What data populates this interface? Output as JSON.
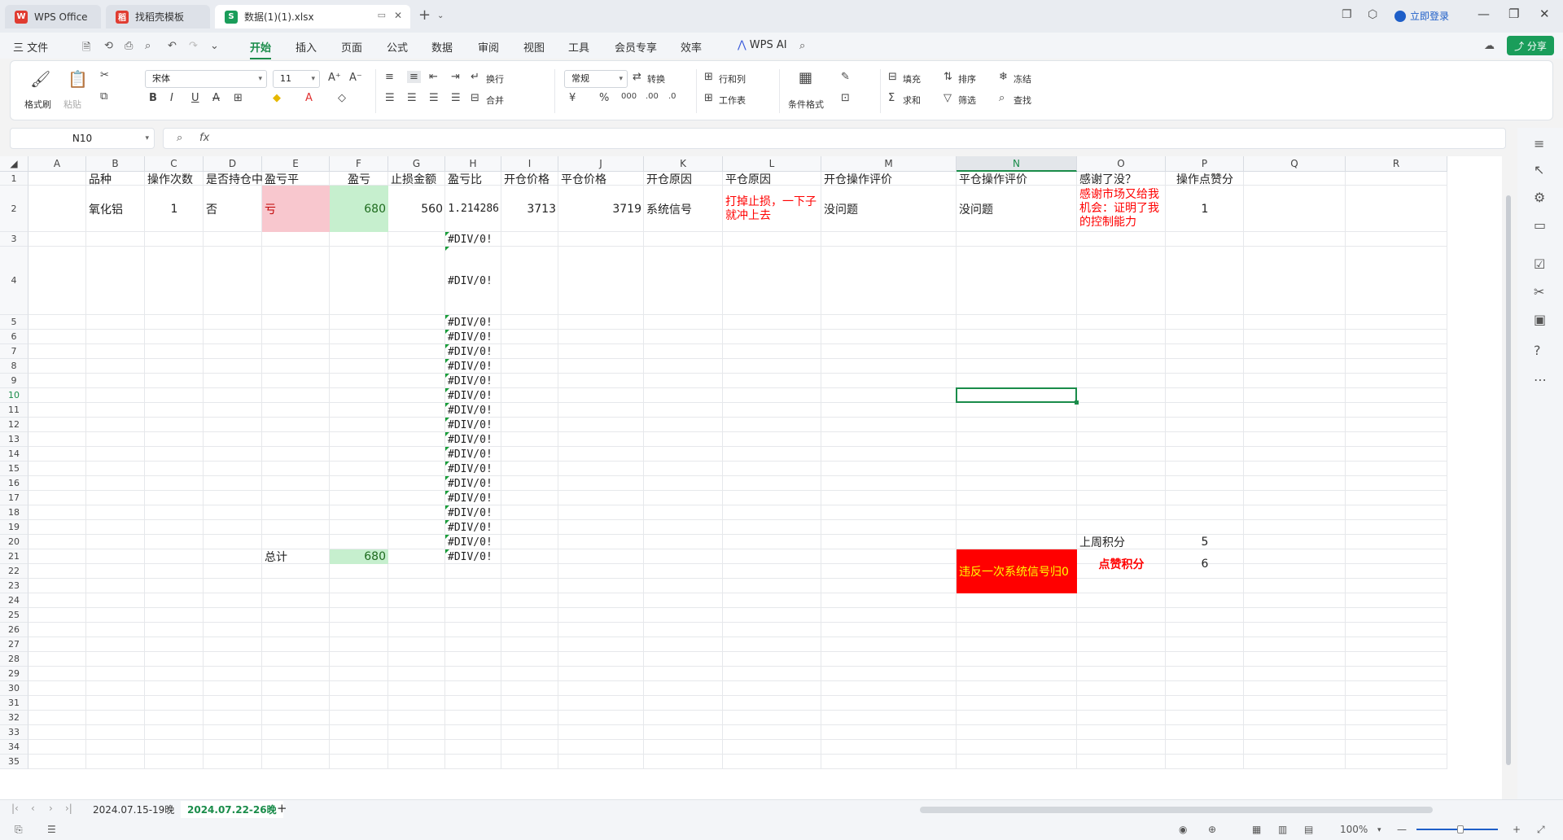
{
  "titlebar": {
    "tabs": [
      {
        "label": "WPS Office",
        "logo": "W",
        "logo_color": "#e03c31"
      },
      {
        "label": "找稻壳模板",
        "logo": "稻",
        "logo_color": "#e03c31"
      },
      {
        "label": "数据(1)(1).xlsx",
        "logo": "S",
        "logo_color": "#1a9d5a"
      }
    ],
    "login_label": "立即登录"
  },
  "menu": {
    "file_label": "三 文件",
    "items": [
      "开始",
      "插入",
      "页面",
      "公式",
      "数据",
      "审阅",
      "视图",
      "工具",
      "会员专享",
      "效率"
    ],
    "ai_label": "WPS AI",
    "share_label": "分享"
  },
  "ribbon": {
    "format_painter": "格式刷",
    "paste": "粘贴",
    "font_name": "宋体",
    "font_size": "11",
    "wrap": "换行",
    "merge": "合并",
    "number_format": "常规",
    "convert": "转换",
    "row_col": "行和列",
    "worksheet": "工作表",
    "cond_format": "条件格式",
    "fill": "填充",
    "sort": "排序",
    "freeze": "冻结",
    "sum": "求和",
    "filter": "筛选",
    "find": "查找"
  },
  "formula_bar": {
    "name_box": "N10",
    "fx_label": "fx",
    "formula": ""
  },
  "columns": [
    "A",
    "B",
    "C",
    "D",
    "E",
    "F",
    "G",
    "H",
    "I",
    "J",
    "K",
    "L",
    "M",
    "N",
    "O",
    "P",
    "Q",
    "R"
  ],
  "selected_cell": "N10",
  "rows": [
    "1",
    "2",
    "3",
    "4",
    "5",
    "6",
    "7",
    "8",
    "9",
    "10",
    "11",
    "12",
    "13",
    "14",
    "15",
    "16",
    "17",
    "18",
    "19",
    "20",
    "21",
    "22",
    "23",
    "24",
    "25",
    "26",
    "27",
    "28",
    "29",
    "30",
    "31",
    "32",
    "33",
    "34",
    "35"
  ],
  "cells": {
    "B1": "品种",
    "C1": "操作次数",
    "D1": "是否持仓中",
    "E1": "盈亏平",
    "F1": "盈亏",
    "G1": "止损金额",
    "H1": "盈亏比",
    "I1": "开仓价格",
    "J1": "平仓价格",
    "K1": "开仓原因",
    "L1": "平仓原因",
    "M1": "开仓操作评价",
    "N1": "平仓操作评价",
    "O1": "感谢了没？",
    "P1": "操作点赞分",
    "B2": "氧化铝",
    "C2": "1",
    "D2": "否",
    "E2": "亏",
    "F2": "680",
    "G2": "560",
    "H2": "1.214286",
    "I2": "3713",
    "J2": "3719",
    "K2": "系统信号",
    "L2": "打掉止损，一下子就冲上去",
    "M2": "没问题",
    "N2": "没问题",
    "O2": "感谢市场又给我机会：证明了我的控制能力",
    "P2": "1",
    "div_error": "#DIV/0!",
    "O20": "上周积分",
    "P20": "5",
    "E21": "总计",
    "F21": "680",
    "N21": "违反一次系统信号归0",
    "O21": "点赞积分",
    "P21": "6"
  },
  "sheet_tabs": [
    "2024.07.15-19晚",
    "2024.07.22-26晚"
  ],
  "status": {
    "zoom": "100%"
  },
  "colors": {
    "accent": "#1a8c4a",
    "loss_fill": "#f8c7ce",
    "gain_fill": "#c6efce",
    "alert_fill": "#ff0000",
    "alert_text": "#ffff00",
    "red_text": "#ff0000"
  }
}
